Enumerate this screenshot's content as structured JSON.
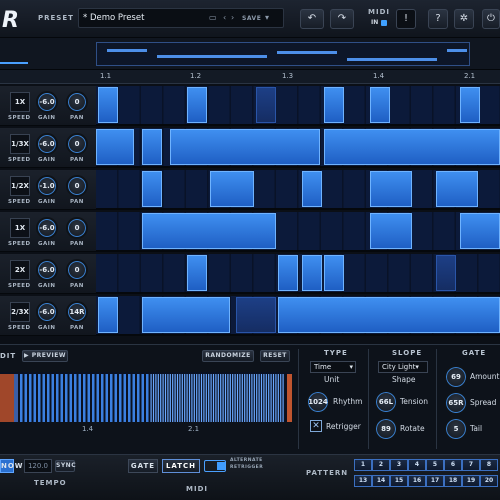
{
  "header": {
    "logo": "R",
    "preset_label": "PRESET",
    "preset_name": "* Demo Preset",
    "save_label": "SAVE",
    "now_label": "NOW",
    "midi_label": "MIDI",
    "midi_state": "IN",
    "undo_icon": "undo-icon",
    "redo_icon": "redo-icon"
  },
  "ruler": {
    "markers": [
      "1.1",
      "1.2",
      "1.3",
      "1.4",
      "2.1"
    ]
  },
  "lanes": [
    {
      "speed": "1X",
      "gain": "-6.0",
      "pan": "0"
    },
    {
      "speed": "1/3X",
      "gain": "-6.0",
      "pan": "0"
    },
    {
      "speed": "1/2X",
      "gain": "-1.0",
      "pan": "0"
    },
    {
      "speed": "1X",
      "gain": "-6.0",
      "pan": "0"
    },
    {
      "speed": "2X",
      "gain": "-6.0",
      "pan": "0"
    },
    {
      "speed": "2/3X",
      "gain": "-6.0",
      "pan": "14R"
    }
  ],
  "lane_labels": {
    "speed": "SPEED",
    "gain": "GAIN",
    "pan": "PAN"
  },
  "editor": {
    "edit_label": "DIT",
    "preview_label": "PREVIEW",
    "randomize_label": "RANDOMIZE",
    "reset_label": "RESET",
    "marker_a": "1.4",
    "marker_b": "2.1",
    "type": {
      "title": "TYPE",
      "value": "Time",
      "sub": "Unit",
      "rhythm_value": "1024",
      "rhythm_label": "Rhythm",
      "retrigger_label": "Retrigger"
    },
    "slope": {
      "title": "SLOPE",
      "shape_value": "City Light",
      "shape_label": "Shape",
      "tension_value": "66L",
      "tension_label": "Tension",
      "rotate_value": "89",
      "rotate_label": "Rotate"
    },
    "gate": {
      "title": "GATE",
      "amount_value": "69",
      "amount_label": "Amount",
      "spread_value": "65R",
      "spread_label": "Spread",
      "tail_value": "5",
      "tail_label": "Tail"
    }
  },
  "footer": {
    "tempo_value": "120.0",
    "sync_label": "SYNC",
    "tempo_label": "TEMPO",
    "gate_label": "GATE",
    "latch_label": "LATCH",
    "alternate_label": "ALTERNATE",
    "retrigger_label": "RETRIGGER",
    "midi_label": "MIDI",
    "pattern_label": "PATTERN",
    "patterns": [
      "1",
      "2",
      "3",
      "4",
      "5",
      "6",
      "7",
      "8",
      "13",
      "14",
      "15",
      "16",
      "17",
      "18",
      "19",
      "20"
    ]
  }
}
